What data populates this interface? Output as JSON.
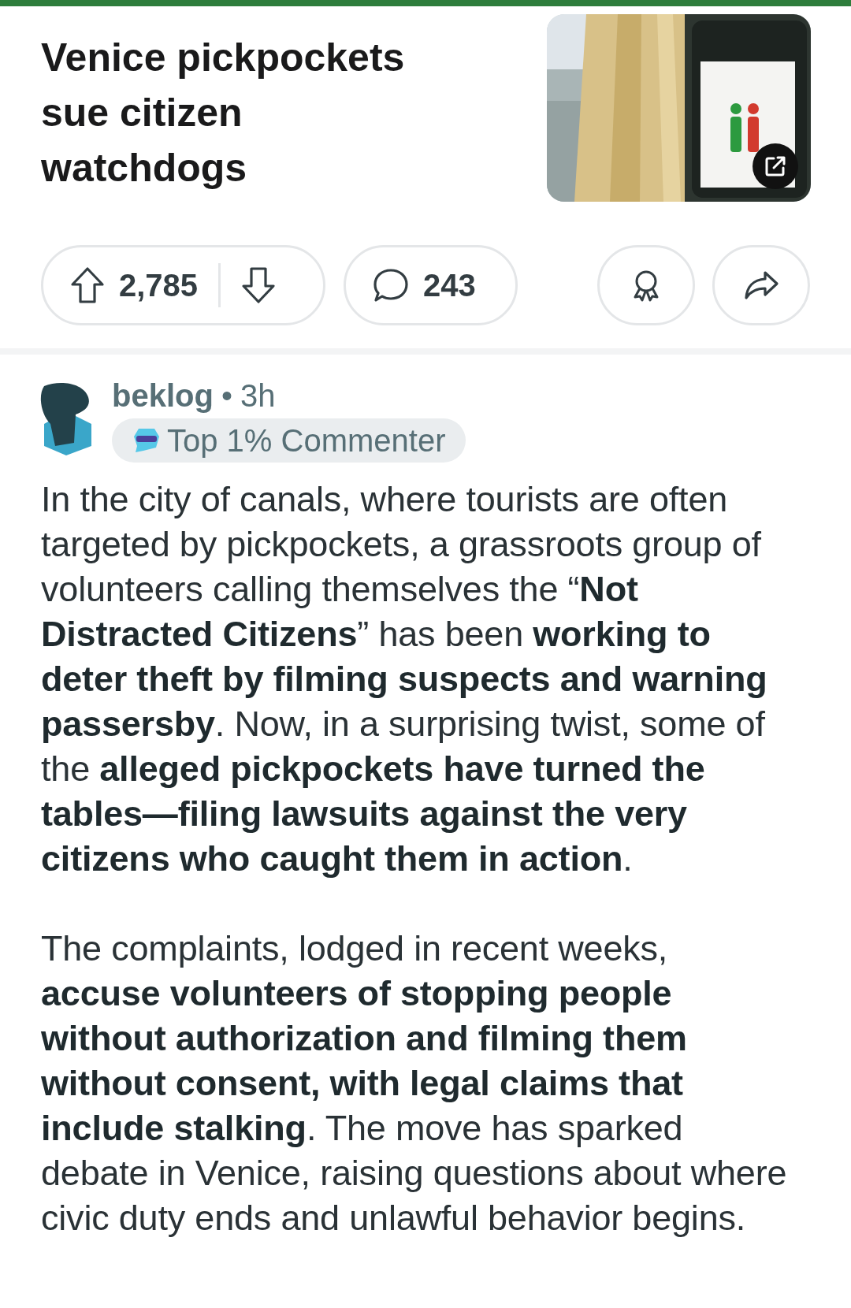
{
  "post": {
    "title": "Venice pickpockets sue citizen watchdogs",
    "actions": {
      "votes": "2,785",
      "comments": "243"
    }
  },
  "comment": {
    "author": "beklog",
    "time": "3h",
    "separator": "•",
    "badge": "Top 1% Commenter",
    "paragraphs": [
      "In the city of canals, where tourists are often targeted by pickpockets, a grassroots group of volunteers calling themselves the “**Not Distracted Citizens**” has been **working to deter theft by filming suspects and warning passersby**. Now, in a surprising twist, some of the **alleged pickpockets have turned the tables—filing lawsuits against the very citizens who caught them in action**.",
      "The complaints, lodged in recent weeks, **accuse volunteers of stopping people without authorization and filming them without consent, with legal claims that include stalking**. The move has sparked debate in Venice, raising questions about where civic duty ends and unlawful behavior begins."
    ]
  }
}
